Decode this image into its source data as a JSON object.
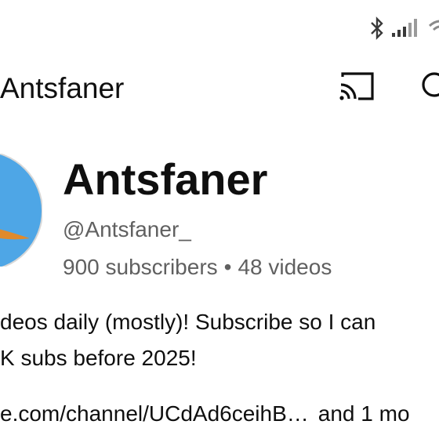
{
  "status_bar": {
    "icons": [
      "bluetooth-icon",
      "signal-icon",
      "wifi-icon"
    ]
  },
  "app_bar": {
    "title": "Antsfaner",
    "cast_icon": "cast-icon",
    "search_icon": "search-icon"
  },
  "channel": {
    "name": "Antsfaner",
    "handle": "@Antsfaner_",
    "subscribers": "900 subscribers",
    "separator": "•",
    "videos": "48 videos",
    "avatar_colors": {
      "background": "#4ea6e6",
      "border": "#d8d8d8"
    }
  },
  "description": {
    "line1": "deos daily (mostly)! Subscribe so I can",
    "line2": " K subs before 2025!"
  },
  "links": {
    "primary": "e.com/channel/UCdAd6ceihB…",
    "more": "and 1 mo"
  },
  "colors": {
    "text_primary": "#0f0f0f",
    "text_secondary": "#606060",
    "background": "#ffffff"
  }
}
